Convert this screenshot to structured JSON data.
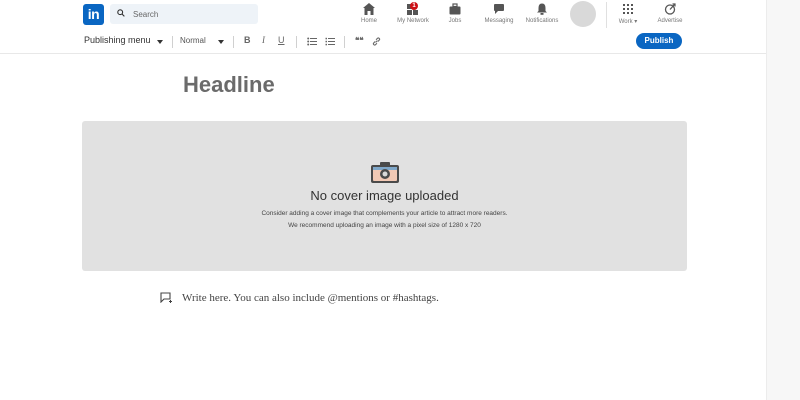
{
  "brand": {
    "logo_text": "in",
    "accent": "#0a66c2"
  },
  "search": {
    "placeholder": "Search"
  },
  "nav": {
    "items": [
      {
        "label": "Home",
        "icon": "home-icon"
      },
      {
        "label": "My Network",
        "icon": "network-icon",
        "badge": "1"
      },
      {
        "label": "Jobs",
        "icon": "briefcase-icon"
      },
      {
        "label": "Messaging",
        "icon": "chat-icon"
      },
      {
        "label": "Notifications",
        "icon": "bell-icon"
      }
    ],
    "work_label": "Work",
    "advertise_label": "Advertise"
  },
  "toolbar": {
    "publishing_menu": "Publishing menu",
    "style_select": "Normal",
    "bold": "B",
    "italic": "I",
    "underline": "U",
    "quote": "❝❝",
    "publish_label": "Publish"
  },
  "editor": {
    "headline": "Headline",
    "cover_title": "No cover image uploaded",
    "cover_line1": "Consider adding a cover image that complements your article to attract more readers.",
    "cover_line2": "We recommend uploading an image with a pixel size of 1280 x 720",
    "body_placeholder": "Write here. You can also include @mentions or #hashtags."
  }
}
